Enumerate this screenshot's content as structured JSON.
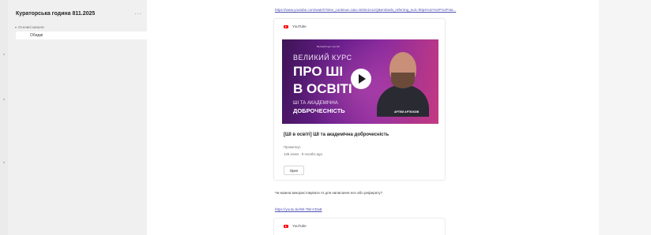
{
  "sidebar": {
    "team_title": "Кураторська година 811.2025",
    "more_label": "···",
    "section_label": "Основні канали",
    "channel_item": "Обидві"
  },
  "post": {
    "link_1": "https://www.youtube.com/watch?time_continue=1&v=5G8o1n1zQ&embeds_referring_euri=https%3A%2F%2Fsta...",
    "card": {
      "source": "YouTube",
      "thumb_top": "Великий курс про ШІ",
      "thumb_line1": "ВЕЛИКИЙ КУРС",
      "thumb_line2": "ПРО ШІ",
      "thumb_line3": "В ОСВІТІ",
      "thumb_line4": "ШІ ТА АКАДЕМІЧНА",
      "thumb_line5": "ДОБРОЧЕСНІСТЬ",
      "thumb_name": "АРТЕМ АРТЮХОВ",
      "video_title": "[ШІ в освіті] ШІ та академічна доброчесність",
      "channel": "Прометеус",
      "meta": "138 views · 9 months ago",
      "open_label": "Open"
    },
    "message": "Чи можна використовувати AI для написання есе або реферату?",
    "link_2": "https://youtu.be/Wl-7BinYDaB",
    "card_2_source": "YouTube"
  },
  "colors": {
    "link": "#4f52b2",
    "youtube": "#ff0000",
    "thumb_purple": "#6a1f8c"
  }
}
